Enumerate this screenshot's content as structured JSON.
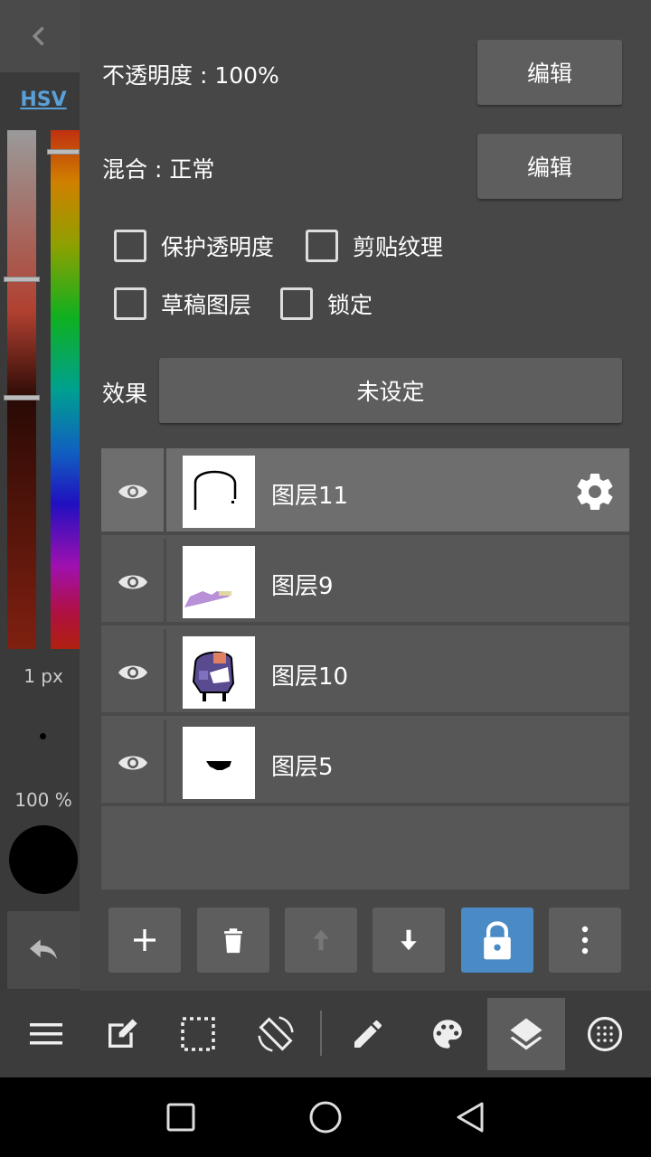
{
  "color_panel": {
    "mode_label": "HSV",
    "brush_size": "1 px",
    "brush_opacity": "100 %",
    "current_color": "#000000"
  },
  "layer_props": {
    "opacity_label": "不透明度 : 100%",
    "opacity_edit": "编辑",
    "blend_label": "混合 : 正常",
    "blend_edit": "编辑",
    "checkboxes": [
      {
        "label": "保护透明度",
        "checked": false
      },
      {
        "label": "剪贴纹理",
        "checked": false
      },
      {
        "label": "草稿图层",
        "checked": false
      },
      {
        "label": "锁定",
        "checked": false
      }
    ],
    "effect_label": "效果",
    "effect_value": "未设定"
  },
  "layers": [
    {
      "name": "图层11",
      "visible": true,
      "selected": true
    },
    {
      "name": "图层9",
      "visible": true,
      "selected": false
    },
    {
      "name": "图层10",
      "visible": true,
      "selected": false
    },
    {
      "name": "图层5",
      "visible": true,
      "selected": false
    }
  ],
  "layer_actions": [
    "add-icon",
    "trash-icon",
    "arrow-up-icon",
    "arrow-down-icon",
    "lock-icon",
    "more-vertical-icon"
  ],
  "toolbar": [
    "menu-icon",
    "edit-icon",
    "selection-icon",
    "rotate-screen-icon",
    "pencil-icon",
    "palette-icon",
    "layers-icon",
    "grid-icon"
  ],
  "colors": {
    "accent": "#4a8bc6",
    "link": "#5aa0d8",
    "panel": "#474747"
  }
}
